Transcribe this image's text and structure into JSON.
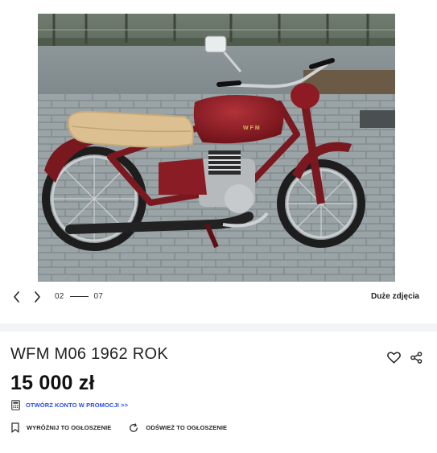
{
  "gallery": {
    "current_index": "02",
    "total": "07",
    "big_photos_label": "Duże zdjęcia",
    "photo_badge_text": "WFM"
  },
  "listing": {
    "title": "WFM M06 1962 ROK",
    "price": "15 000 zł"
  },
  "promo": {
    "label": "OTWÓRZ KONTO W PROMOCJI >>",
    "color": "#2a4ce8"
  },
  "actions": {
    "highlight_label": "WYRÓŻNIJ TO OGŁOSZENIE",
    "refresh_label": "ODŚWIEŻ TO OGŁOSZENIE"
  },
  "icons": {
    "prev": "chevron-left-icon",
    "next": "chevron-right-icon",
    "favorite": "heart-icon",
    "share": "share-icon",
    "promo": "calculator-icon",
    "highlight": "bookmark-icon",
    "refresh": "refresh-icon"
  }
}
